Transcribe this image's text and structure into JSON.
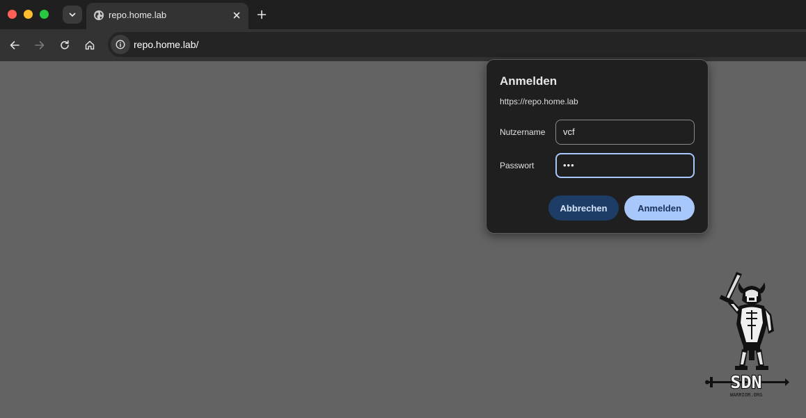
{
  "tab": {
    "title": "repo.home.lab"
  },
  "omnibox": {
    "url": "repo.home.lab/"
  },
  "dialog": {
    "title": "Anmelden",
    "origin": "https://repo.home.lab",
    "username_label": "Nutzername",
    "username_value": "vcf",
    "password_label": "Passwort",
    "password_value": "•••",
    "cancel_label": "Abbrechen",
    "submit_label": "Anmelden"
  },
  "logo": {
    "text": "SDN",
    "subtext": "WARRIOR.ORG"
  },
  "icons": {
    "tab_favicon": "globe-icon",
    "tab_close": "close-icon",
    "new_tab": "plus-icon",
    "tab_menu": "chevron-down-icon",
    "back": "arrow-left-icon",
    "forward": "arrow-right-icon",
    "reload": "reload-icon",
    "home": "home-icon",
    "site_info": "info-icon"
  },
  "colors": {
    "accent": "#a8c7fa",
    "cancel_button": "#1d3d66",
    "page_background": "#636363"
  }
}
